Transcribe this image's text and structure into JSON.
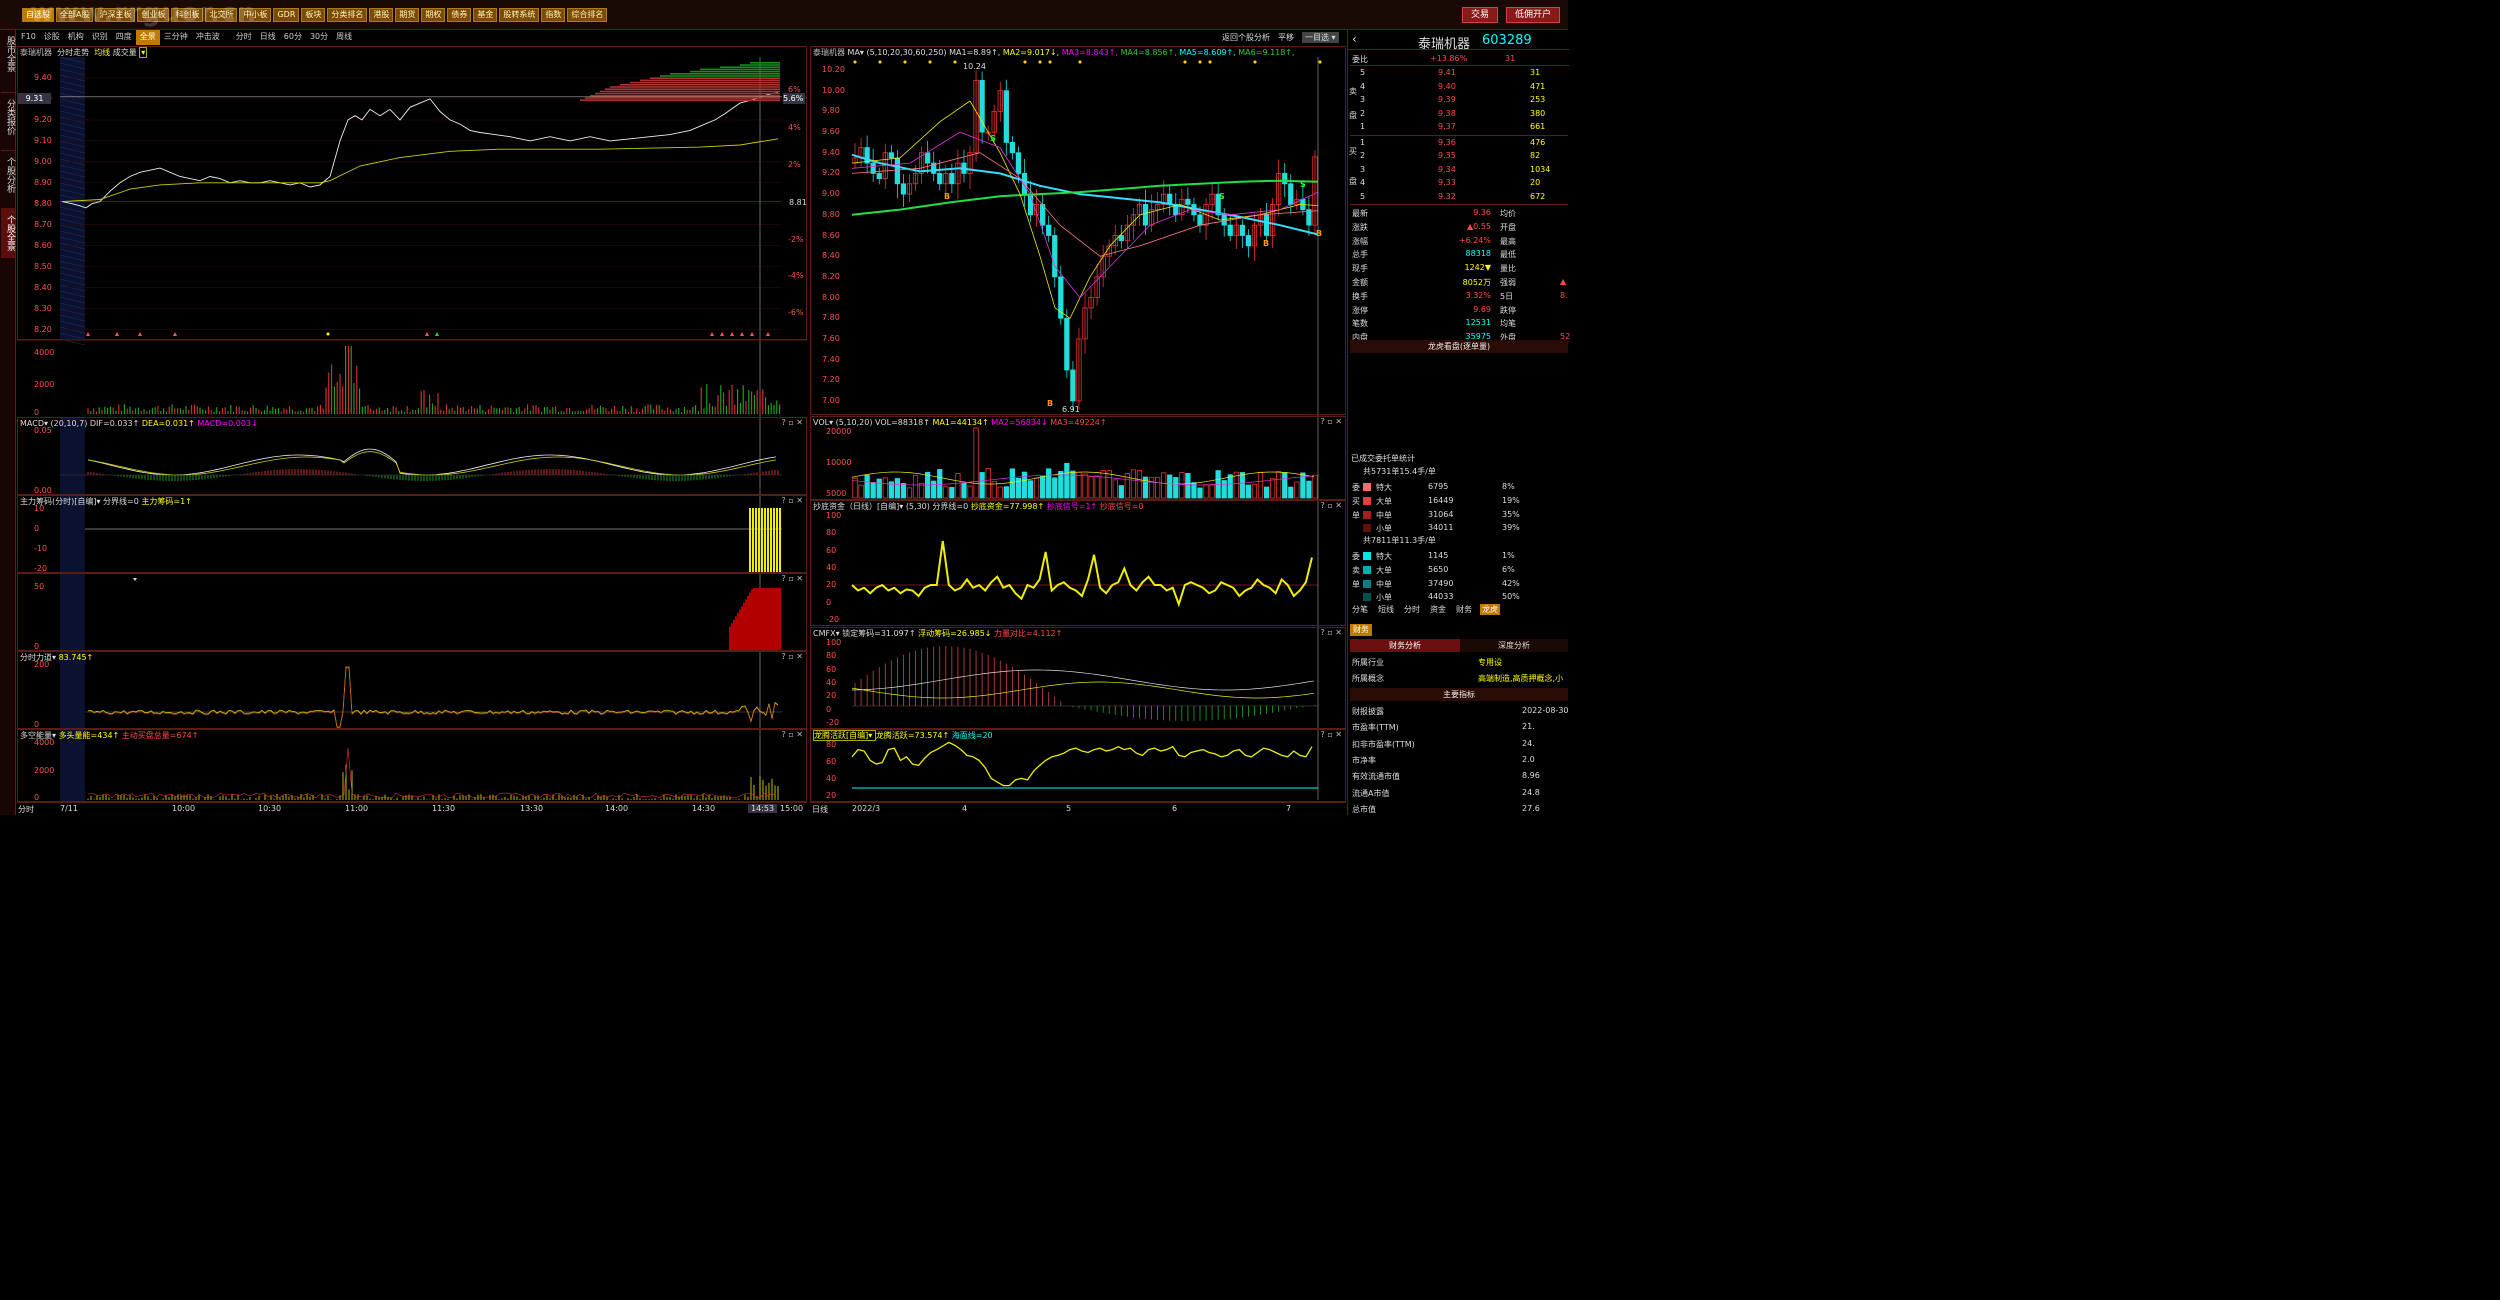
{
  "top_menu": [
    "自选股",
    "全部A股",
    "沪深主板",
    "创业板",
    "科创板",
    "北交所",
    "中小板",
    "GDR",
    "板块",
    "分类排名",
    "港股",
    "期货",
    "期权",
    "债券",
    "基金",
    "股转系统",
    "指数",
    "综合排名"
  ],
  "watermark": "www.rrguor.cn",
  "trade_buttons": [
    "交易",
    "低佣开户"
  ],
  "side_tabs": [
    "股市全景",
    "分类报价",
    "个股分析",
    "个股全景"
  ],
  "sub_tabs": [
    "F10",
    "诊股",
    "机构",
    "识别",
    "四度",
    "全景",
    "三分钟",
    "冲击波",
    "分时",
    "日线",
    "60分",
    "30分",
    "周线"
  ],
  "intraday": {
    "stock": "泰瑞机器",
    "mode": "分时走势",
    "legend": [
      "均线",
      "成交量"
    ],
    "price_ticks": [
      "9.40",
      "9.30",
      "9.20",
      "9.10",
      "9.00",
      "8.90",
      "8.80",
      "8.70",
      "8.60",
      "8.50",
      "8.40",
      "8.30",
      "8.20"
    ],
    "pct_ticks": [
      "6%",
      "4%",
      "2%",
      "-2%",
      "-4%",
      "-6%"
    ],
    "cur_price": "9.31",
    "cur_pct": "5.6%",
    "prev_close": "8.81",
    "vol_ticks": [
      "4000",
      "2000",
      "0"
    ],
    "time_ticks": [
      "分时",
      "7/11",
      "10:00",
      "10:30",
      "11:00",
      "11:30",
      "13:30",
      "14:00",
      "14:30",
      "14:53",
      "15:00"
    ]
  },
  "indicators_left": [
    {
      "name": "MACD",
      "params": "(20,10,7)",
      "vals": [
        {
          "t": "DIF=0.033↑",
          "c": "wh"
        },
        {
          "t": "DEA=0.031↑",
          "c": "yl"
        },
        {
          "t": "MACD=0.003↓",
          "c": "mg"
        }
      ],
      "ticks": [
        "0.05",
        "0.00"
      ]
    },
    {
      "name": "主力筹码(分时)[自编]",
      "params": "",
      "vals": [
        {
          "t": "分界线=0",
          "c": "wh"
        },
        {
          "t": "主力筹码=1↑",
          "c": "yl"
        }
      ],
      "ticks": [
        "10",
        "0",
        "-10",
        "-20"
      ]
    },
    {
      "name": "",
      "params": "",
      "vals": [],
      "ticks": [
        "50",
        "0"
      ]
    },
    {
      "name": "分时力道",
      "params": "",
      "vals": [
        {
          "t": "83.745↑",
          "c": "yl"
        }
      ],
      "ticks": [
        "200",
        "0"
      ]
    },
    {
      "name": "多空能量",
      "params": "",
      "vals": [
        {
          "t": "多头量能=434↑",
          "c": "yl"
        },
        {
          "t": "主动买盘总量=674↑",
          "c": "rd"
        }
      ],
      "ticks": [
        "4000",
        "2000",
        "0"
      ]
    }
  ],
  "daily": {
    "stock": "泰瑞机器",
    "ma_label": "MA",
    "params": "(5,10,20,30,60,250)",
    "ma_vals": [
      {
        "t": "MA1=8.89↑",
        "c": "wh"
      },
      {
        "t": "MA2=9.017↓",
        "c": "yl"
      },
      {
        "t": "MA3=8.843↑",
        "c": "mg"
      },
      {
        "t": "MA4=8.856↑",
        "c": "gr"
      },
      {
        "t": "MA5=8.609↑",
        "c": "cy"
      },
      {
        "t": "MA6=9.118↑",
        "c": "gr"
      }
    ],
    "price_ticks": [
      "10.20",
      "10.00",
      "9.80",
      "9.60",
      "9.40",
      "9.20",
      "9.00",
      "8.80",
      "8.60",
      "8.40",
      "8.20",
      "8.00",
      "7.80",
      "7.60",
      "7.40",
      "7.20",
      "7.00"
    ],
    "high_label": "10.24",
    "low_label": "6.91",
    "right_btns": [
      "返回个股分析",
      "平移",
      "一目选"
    ],
    "date_ticks": [
      "日线",
      "2022/3",
      "4",
      "5",
      "6",
      "7"
    ]
  },
  "indicators_right": [
    {
      "name": "VOL",
      "params": "(5,10,20)",
      "vals": [
        {
          "t": "VOL=88318↑",
          "c": "wh"
        },
        {
          "t": "MA1=44134↑",
          "c": "yl"
        },
        {
          "t": "MA2=56834↓",
          "c": "mg"
        },
        {
          "t": "MA3=49224↑",
          "c": "rd"
        }
      ],
      "ticks": [
        "20000",
        "10000",
        "5000"
      ]
    },
    {
      "name": "抄底资金（日线）[自编]",
      "params": "(5,30)",
      "vals": [
        {
          "t": "分界线=0",
          "c": "wh"
        },
        {
          "t": "抄底资金=77.998↑",
          "c": "yl"
        },
        {
          "t": "抄底信号=1↑",
          "c": "mg"
        },
        {
          "t": "抄底信号=0",
          "c": "rd"
        }
      ],
      "ticks": [
        "100",
        "80",
        "60",
        "40",
        "20",
        "0",
        "-20"
      ]
    },
    {
      "name": "CMFX",
      "params": "",
      "vals": [
        {
          "t": "锁定筹码=31.097↑",
          "c": "wh"
        },
        {
          "t": "浮动筹码=26.985↓",
          "c": "yl"
        },
        {
          "t": "力量对比=4.112↑",
          "c": "rd"
        }
      ],
      "ticks": [
        "100",
        "80",
        "60",
        "40",
        "20",
        "0",
        "-20"
      ]
    },
    {
      "name": "龙腾活跃[自编]",
      "params": "",
      "vals": [
        {
          "t": "龙腾活跃=73.574↑",
          "c": "yl"
        },
        {
          "t": "海面线=20",
          "c": "cy"
        }
      ],
      "ticks": [
        "80",
        "60",
        "40",
        "20"
      ]
    }
  ],
  "quote": {
    "name": "泰瑞机器",
    "code": "603289",
    "weibi": {
      "label": "委比",
      "val": "+13.86%",
      "cnt": "31"
    },
    "sells": [
      [
        "卖5",
        "9.41",
        "31"
      ],
      [
        "卖4",
        "9.40",
        "471"
      ],
      [
        "卖3",
        "9.39",
        "253"
      ],
      [
        "卖2",
        "9.38",
        "380"
      ],
      [
        "卖1",
        "9.37",
        "661"
      ]
    ],
    "buys": [
      [
        "买1",
        "9.36",
        "476"
      ],
      [
        "买2",
        "9.35",
        "82"
      ],
      [
        "买3",
        "9.34",
        "1034"
      ],
      [
        "买4",
        "9.33",
        "20"
      ],
      [
        "买5",
        "9.32",
        "672"
      ]
    ],
    "stats": [
      [
        "最新",
        "9.36",
        "均价",
        ""
      ],
      [
        "涨跌",
        "▲0.55",
        "开盘",
        ""
      ],
      [
        "涨幅",
        "+6.24%",
        "最高",
        ""
      ],
      [
        "总手",
        "88318",
        "最低",
        ""
      ],
      [
        "现手",
        "1242▼",
        "量比",
        ""
      ],
      [
        "金额",
        "8052万",
        "强弱",
        "▲"
      ],
      [
        "换手",
        "3.32%",
        "5日",
        "8."
      ],
      [
        "涨停",
        "9.69",
        "跌停",
        ""
      ],
      [
        "笔数",
        "12531",
        "均笔",
        ""
      ],
      [
        "内盘",
        "35975",
        "外盘",
        "52"
      ]
    ],
    "pie_title": "龙虎看盘(逐单量)",
    "order_title": "已成交委托单统计",
    "buy_total": "共5731单15.4手/单",
    "buy_rows": [
      [
        "特大",
        "6795",
        "8%",
        "#ff6a6a"
      ],
      [
        "大单",
        "16449",
        "19%",
        "#e04040"
      ],
      [
        "中单",
        "31064",
        "35%",
        "#a02020"
      ],
      [
        "小单",
        "34011",
        "39%",
        "#601010"
      ]
    ],
    "sell_total": "共7811单11.3手/单",
    "sell_rows": [
      [
        "特大",
        "1145",
        "1%",
        "#00e5e5"
      ],
      [
        "大单",
        "5650",
        "6%",
        "#00b0b0"
      ],
      [
        "中单",
        "37490",
        "42%",
        "#008080"
      ],
      [
        "小单",
        "44033",
        "50%",
        "#005050"
      ]
    ],
    "bottom_tabs": [
      "分笔",
      "短线",
      "分时",
      "资金",
      "财务",
      "龙虎"
    ],
    "fin_tab": "财务",
    "fin_tabs": [
      "财务分析",
      "深度分析"
    ],
    "fin_rows": [
      [
        "所属行业",
        "专用设"
      ],
      [
        "所属概念",
        "高端制造,高质押概念,小"
      ]
    ],
    "main_title": "主要指标",
    "main_rows": [
      [
        "财报披露",
        "2022-08-30"
      ],
      [
        "市盈率(TTM)",
        "21."
      ],
      [
        "扣非市盈率(TTM)",
        "24."
      ],
      [
        "市净率",
        "2.0"
      ],
      [
        "有效流通市值",
        "8.96"
      ],
      [
        "流通A市值",
        "24.8"
      ],
      [
        "总市值",
        "27.6"
      ]
    ]
  }
}
